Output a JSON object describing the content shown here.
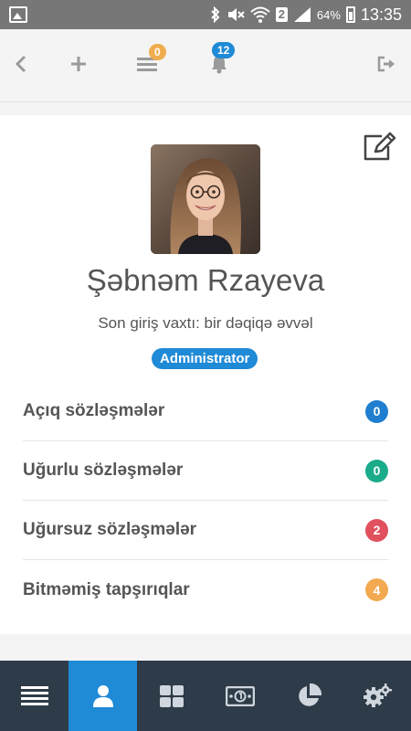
{
  "status_bar": {
    "icons": [
      "gallery-icon",
      "bluetooth-icon",
      "mute-icon",
      "wifi-icon",
      "signal-icon",
      "battery-icon"
    ],
    "sim_label": "2",
    "battery_percent": "64%",
    "time": "13:35"
  },
  "toolbar": {
    "icons": [
      "back-icon",
      "add-icon",
      "list-icon",
      "bell-icon",
      "logout-icon"
    ],
    "list_badge": "0",
    "bell_badge": "12",
    "colors": {
      "icon": "#9a9a9a",
      "list_badge_bg": "#f0ad4e",
      "bell_badge_bg": "#1f8ad6"
    }
  },
  "profile": {
    "name": "Şəbnəm Rzayeva",
    "last_login": "Son giriş vaxtı: bir dəqiqə əvvəl",
    "role": "Administrator",
    "edit_icon": "edit-icon",
    "avatar_icon": "avatar-photo"
  },
  "stats": [
    {
      "label": "Açıq sözləşmələr",
      "count": "0",
      "color": "#1f7ecf"
    },
    {
      "label": "Uğurlu sözləşmələr",
      "count": "0",
      "color": "#1aab8b"
    },
    {
      "label": "Uğursuz sözləşmələr",
      "count": "2",
      "color": "#e0505d"
    },
    {
      "label": "Bitməmiş tapşırıqlar",
      "count": "4",
      "color": "#f2a950"
    }
  ],
  "bottom_nav": {
    "items": [
      "menu-icon",
      "user-icon",
      "grid-icon",
      "money-icon",
      "pie-chart-icon",
      "settings-icon"
    ],
    "active": "user-icon",
    "colors": {
      "bg": "#2e3b48",
      "active_bg": "#1f8ad6",
      "icon": "#cfd6dd"
    }
  }
}
